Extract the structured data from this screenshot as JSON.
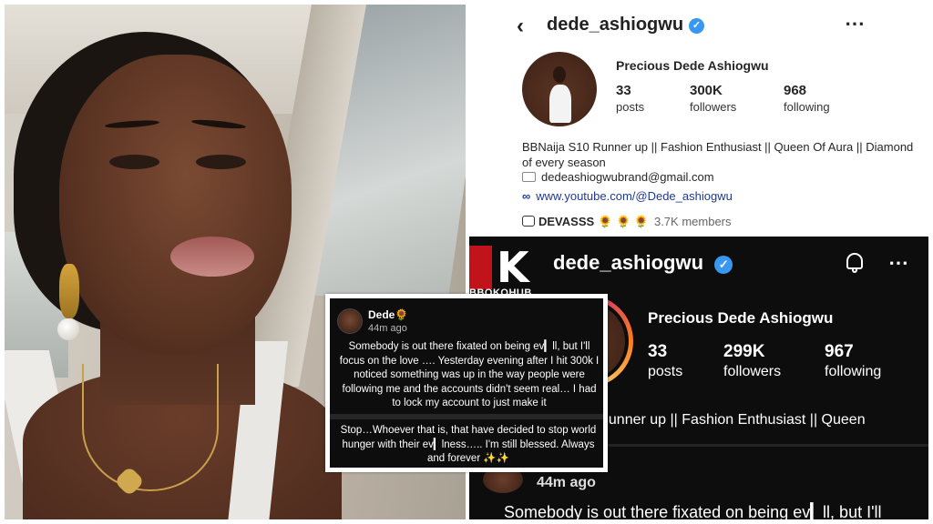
{
  "profile_light": {
    "username": "dede_ashiogwu",
    "full_name": "Precious Dede Ashiogwu",
    "stats": [
      {
        "value": "33",
        "label": "posts"
      },
      {
        "value": "300K",
        "label": "followers"
      },
      {
        "value": "968",
        "label": "following"
      }
    ],
    "bio": "BBNaija S10 Runner up || Fashion Enthusiast || Queen Of Aura || Diamond of every season",
    "email": "dedeashiogwubrand@gmail.com",
    "link": "www.youtube.com/@Dede_ashiogwu",
    "channel": {
      "name": "DEVASSS",
      "emoji": "🌻 🌻 🌻",
      "members": "3.7K members"
    },
    "more_icon": "⋯",
    "back_icon": "‹"
  },
  "profile_dark": {
    "logo_text": "BBOKOHUB",
    "username": "dede_ashiogwu",
    "full_name": "Precious Dede Ashiogwu",
    "stats": [
      {
        "value": "33",
        "label": "posts"
      },
      {
        "value": "299K",
        "label": "followers"
      },
      {
        "value": "967",
        "label": "following"
      }
    ],
    "bio_partial": "0 Runner up || Fashion Enthusiast || Queen",
    "comment_time": "44m ago",
    "comment_text": "Somebody is out there fixated on being ev▎ll, but I'll",
    "more_icon": "⋯"
  },
  "post": {
    "author": "Dede",
    "author_emoji": "🌻",
    "time": "44m ago",
    "text1": "Somebody is out there fixated on being ev▎ll, but I'll focus on the love …. Yesterday evening after I hit 300k  I noticed something was up in the way people were following me and the accounts didn't seem real… I had to lock my account to just make it",
    "text2": "Stop…Whoever that is, that have decided to stop world hunger with their ev▎lness….. I'm still blessed. Always and forever ✨✨"
  },
  "colors": {
    "verified": "#3897f0",
    "link": "#1f3a93",
    "dark_bg": "#0d0d0d",
    "logo_red": "#c0141a"
  }
}
